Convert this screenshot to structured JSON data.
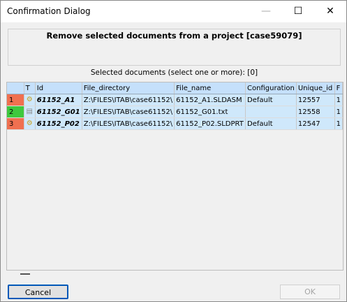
{
  "window": {
    "title": "Confirmation Dialog",
    "minimize_icon": "minimize-icon",
    "maximize_icon": "maximize-icon",
    "close_icon": "close-icon",
    "minimize_glyph": "—",
    "maximize_glyph": "☐",
    "close_glyph": "✕"
  },
  "header": {
    "text": "Remove selected documents from a project [case59079]"
  },
  "selection_label": "Selected documents (select one or more): [0]",
  "table": {
    "columns": [
      "T",
      "Id",
      "File_directory",
      "File_name",
      "Configuration",
      "Unique_id",
      "F"
    ],
    "rows": [
      {
        "num": "1",
        "num_color": "#f07050",
        "type_icon": "assembly-icon",
        "type_glyph": "⚙",
        "id": "61152_A1",
        "dir": "Z:\\FILES\\ITAB\\case61152\\",
        "name": "61152_A1.SLDASM",
        "config": "Default",
        "uid": "12557",
        "f": "1"
      },
      {
        "num": "2",
        "num_color": "#3ec83e",
        "type_icon": "text-file-icon",
        "type_glyph": "▤",
        "id": "61152_G01",
        "dir": "Z:\\FILES\\ITAB\\case61152\\",
        "name": "61152_G01.txt",
        "config": "",
        "uid": "12558",
        "f": "1"
      },
      {
        "num": "3",
        "num_color": "#f07050",
        "type_icon": "part-icon",
        "type_glyph": "⚙",
        "id": "61152_P02",
        "dir": "Z:\\FILES\\ITAB\\case61152\\",
        "name": "61152_P02.SLDPRT",
        "config": "Default",
        "uid": "12547",
        "f": "1"
      }
    ]
  },
  "buttons": {
    "cancel": "Cancel",
    "ok": "OK"
  },
  "colors": {
    "row_bg": "#cfe8fb",
    "header_bg": "#c5e0fb",
    "accent": "#0058b8"
  }
}
